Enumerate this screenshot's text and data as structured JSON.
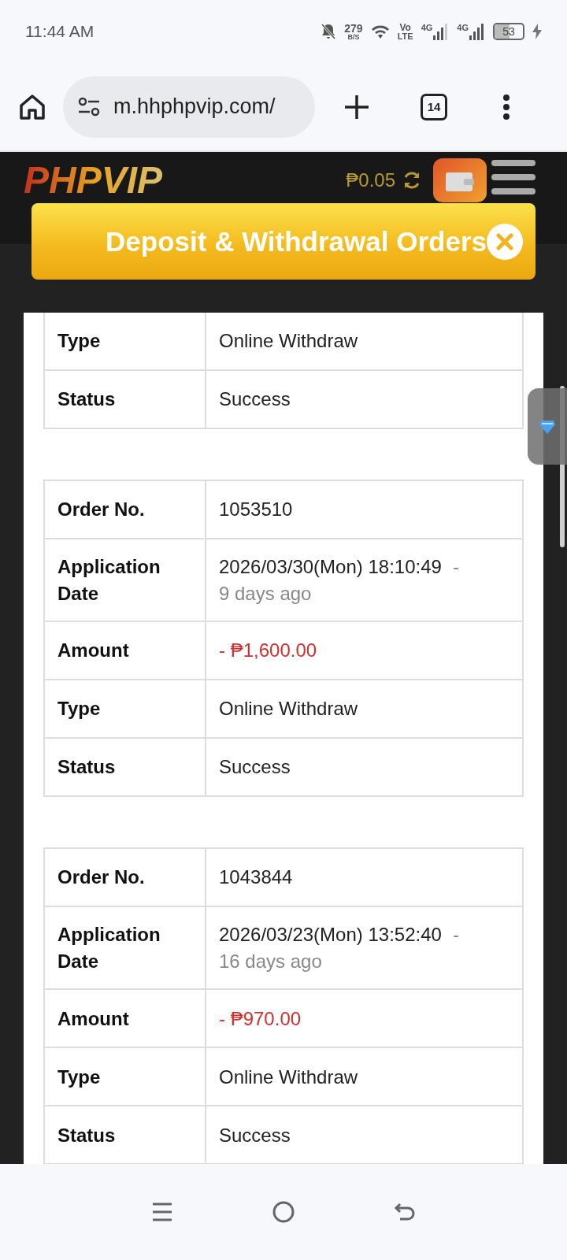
{
  "status_bar": {
    "time": "11:44 AM",
    "net_speed": {
      "value": "279",
      "unit": "B/S"
    },
    "volte": {
      "top": "Vo",
      "bottom": "LTE"
    },
    "sims": [
      "4G",
      "4G"
    ],
    "battery": {
      "text": "53",
      "level": 0.53,
      "charging": true
    }
  },
  "browser": {
    "url": "m.hhphpvip.com/",
    "tab_count": "14"
  },
  "site_header": {
    "logo": "PHPVIP",
    "balance": "₱0.05"
  },
  "modal": {
    "title": "Deposit & Withdrawal Orders",
    "orders": [
      {
        "rows": [
          {
            "kind": "text",
            "label": "Type",
            "value": "Online Withdraw"
          },
          {
            "kind": "text",
            "label": "Status",
            "value": "Success"
          }
        ]
      },
      {
        "rows": [
          {
            "kind": "text",
            "label": "Order No.",
            "value": "1053510"
          },
          {
            "kind": "date",
            "label": "Application Date",
            "value": "2026/03/30(Mon) 18:10:49",
            "separator": "-",
            "relative": "9 days ago"
          },
          {
            "kind": "amount",
            "label": "Amount",
            "value": "- ₱1,600.00"
          },
          {
            "kind": "text",
            "label": "Type",
            "value": "Online Withdraw"
          },
          {
            "kind": "text",
            "label": "Status",
            "value": "Success"
          }
        ]
      },
      {
        "rows": [
          {
            "kind": "text",
            "label": "Order No.",
            "value": "1043844"
          },
          {
            "kind": "date",
            "label": "Application Date",
            "value": "2026/03/23(Mon) 13:52:40",
            "separator": "-",
            "relative": "16 days ago"
          },
          {
            "kind": "amount",
            "label": "Amount",
            "value": "- ₱970.00"
          },
          {
            "kind": "text",
            "label": "Type",
            "value": "Online Withdraw"
          },
          {
            "kind": "text",
            "label": "Status",
            "value": "Success"
          }
        ]
      }
    ]
  }
}
